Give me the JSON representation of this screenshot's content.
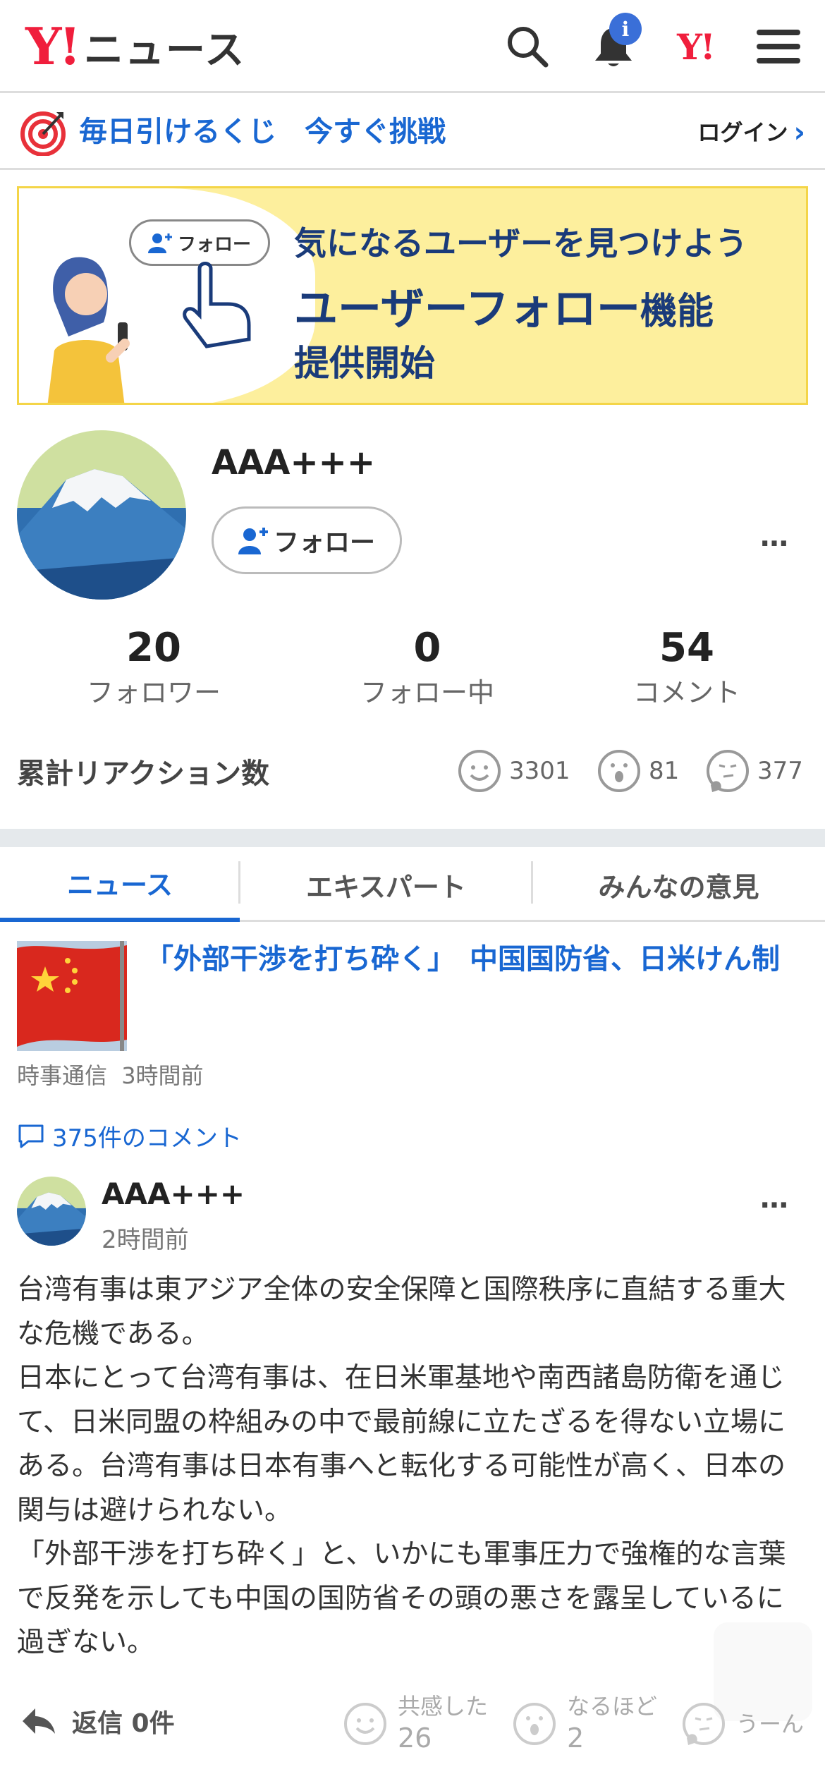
{
  "header": {
    "logo_y": "Y!",
    "logo_text": "ニュース",
    "bell_badge": "i",
    "yahoo_mark": "Y!"
  },
  "lottery": {
    "text": "毎日引けるくじ　今すぐ挑戦",
    "login_label": "ログイン"
  },
  "banner": {
    "follow_chip": "フォロー",
    "line1": "気になるユーザーを見つけよう",
    "line2_main": "ユーザーフォロー",
    "line2_small": "機能",
    "line3": "提供開始"
  },
  "profile": {
    "username": "AAA+++",
    "follow_button": "フォロー",
    "more": "…",
    "stats": [
      {
        "value": "20",
        "label": "フォロワー"
      },
      {
        "value": "0",
        "label": "フォロー中"
      },
      {
        "value": "54",
        "label": "コメント"
      }
    ],
    "reactions_title": "累計リアクション数",
    "reactions": [
      {
        "icon": "smile-icon",
        "count": "3301"
      },
      {
        "icon": "surprised-icon",
        "count": "81"
      },
      {
        "icon": "thinking-icon",
        "count": "377"
      }
    ]
  },
  "tabs": [
    {
      "label": "ニュース",
      "active": true
    },
    {
      "label": "エキスパート",
      "active": false
    },
    {
      "label": "みんなの意見",
      "active": false
    }
  ],
  "article": {
    "title": "「外部干渉を打ち砕く」　中国国防省、日米けん制",
    "source": "時事通信",
    "time": "3時間前",
    "comments_link": "375件のコメント"
  },
  "comment": {
    "user": "AAA+++",
    "time": "2時間前",
    "more": "…",
    "body": [
      "台湾有事は東アジア全体の安全保障と国際秩序に直結する重大な危機である。",
      "日本にとって台湾有事は、在日米軍基地や南西諸島防衛を通じて、日米同盟の枠組みの中で最前線に立たざるを得ない立場にある。台湾有事は日本有事へと転化する可能性が高く、日本の関与は避けられない。",
      "「外部干渉を打ち砕く」と、いかにも軍事圧力で強権的な言葉で反発を示しても中国の国防省その頭の悪さを露呈しているに過ぎない。"
    ],
    "reply": "返信 0件",
    "reactions": [
      {
        "icon": "smile-icon",
        "label": "共感した",
        "count": "26"
      },
      {
        "icon": "surprised-icon",
        "label": "なるほど",
        "count": "2"
      },
      {
        "icon": "thinking-icon",
        "label": "うーん",
        "count": ""
      }
    ]
  },
  "colors": {
    "accent": "#1967d2",
    "brand_red": "#f01e3c",
    "banner_yellow": "#fdef9d",
    "divider": "#e5e9ec"
  }
}
